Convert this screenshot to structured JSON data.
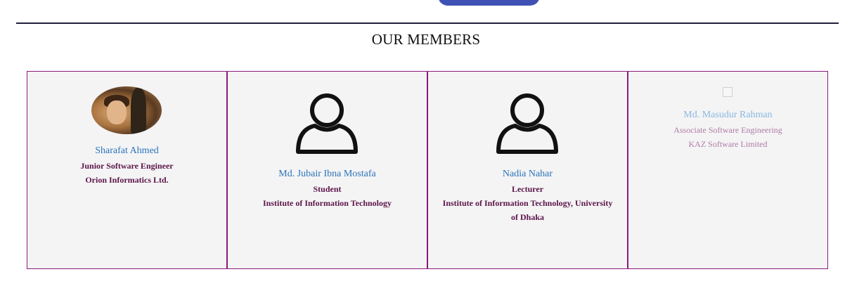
{
  "section": {
    "title": "OUR MEMBERS"
  },
  "colors": {
    "accent": "#8b1a7a",
    "name": "#2b74b8",
    "button": "#3f51b5"
  },
  "members": [
    {
      "name": "Sharafat Ahmed",
      "role": "Junior Software Engineer",
      "org": "Orion Informatics Ltd.",
      "avatar": "photo"
    },
    {
      "name": "Md. Jubair Ibna Mostafa",
      "role": "Student",
      "org": "Institute of Information Technology",
      "avatar": "user-outline-icon"
    },
    {
      "name": "Nadia Nahar",
      "role": "Lecturer",
      "org": "Institute of Information Technology, University of Dhaka",
      "avatar": "user-outline-icon"
    },
    {
      "name": "Md. Masudur Rahman",
      "role": "Associate Software Engineering",
      "org": "KAZ Software Limited",
      "avatar": "broken-image"
    }
  ]
}
